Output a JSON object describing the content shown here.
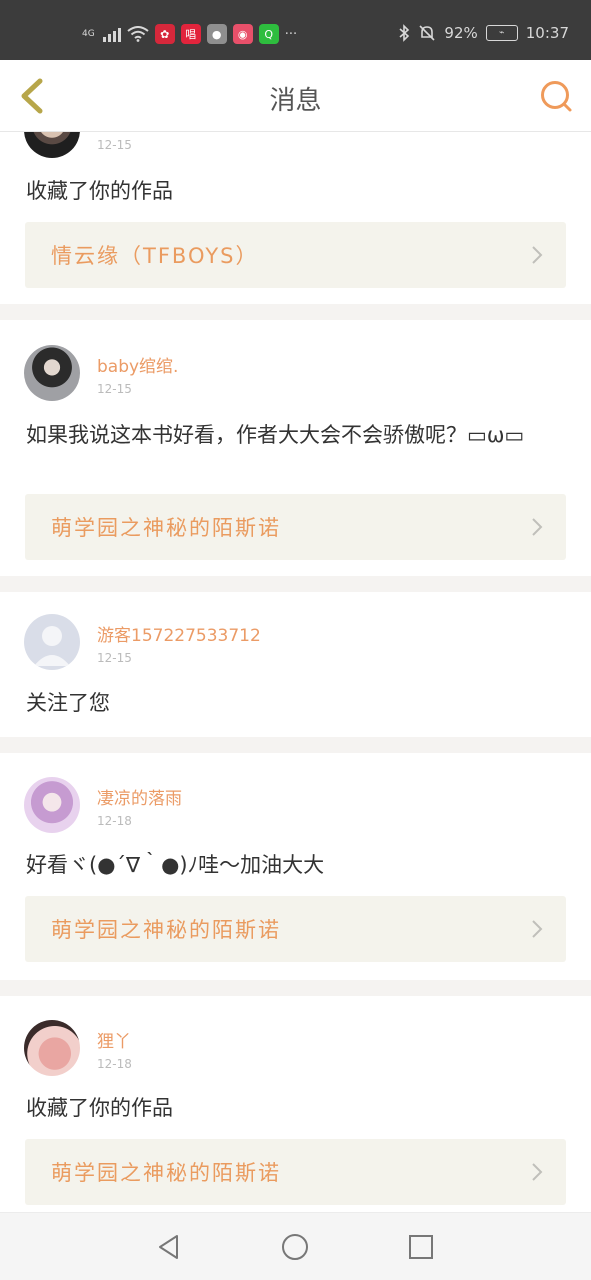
{
  "status": {
    "network": "4G",
    "apps": [
      {
        "name": "huawei-icon",
        "glyph": "✿",
        "color": "#d6283b"
      },
      {
        "name": "chang-ba-icon",
        "glyph": "唱",
        "color": "#e2243c"
      },
      {
        "name": "wechat-icon",
        "glyph": "●",
        "color": "#8f8f8f"
      },
      {
        "name": "xiaohongshu-icon",
        "glyph": "◉",
        "color": "#e8506a"
      },
      {
        "name": "iqiyi-icon",
        "glyph": "Q",
        "color": "#2ebd3e"
      }
    ],
    "more": "···",
    "battery": "92%",
    "time": "10:37"
  },
  "header": {
    "title": "消息"
  },
  "colors": {
    "accent": "#ea9b5f",
    "card_bg": "#f4f3ec"
  },
  "messages": [
    {
      "date": "12-15",
      "text": "收藏了你的作品",
      "work": "情云缘（TFBOYS）",
      "avatar": "man-photo"
    },
    {
      "name": "baby绾绾.",
      "date": "12-15",
      "text": "如果我说这本书好看，作者大大会不会骄傲呢？▭ω▭",
      "work": "萌学园之神秘的陌斯诺",
      "avatar": "girl-photo"
    },
    {
      "name": "游客15722753371​2",
      "date": "12-15",
      "text": "关注了您",
      "avatar": "default-avatar"
    },
    {
      "name": "凄凉的落雨",
      "date": "12-18",
      "text": "好看ヾ(●´∇｀●)ﾉ哇～加油大大",
      "work": "萌学园之神秘的陌斯诺",
      "avatar": "anime-photo"
    },
    {
      "name": "狸丫",
      "date": "12-18",
      "text": "收藏了你的作品",
      "work": "萌学园之神秘的陌斯诺",
      "avatar": "pink-photo"
    }
  ]
}
